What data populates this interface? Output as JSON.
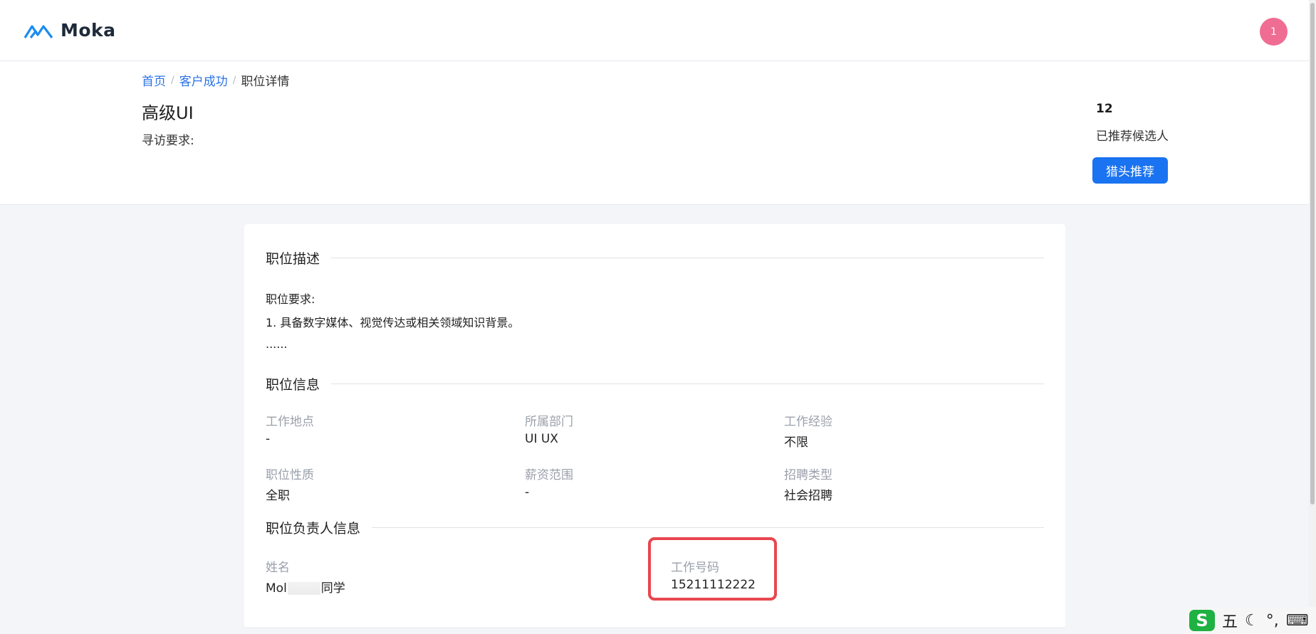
{
  "app": {
    "brand": "Moka",
    "avatar_text": "1"
  },
  "breadcrumb": {
    "items": [
      "首页",
      "客户成功"
    ],
    "current": "职位详情"
  },
  "job": {
    "title": "高级UI",
    "search_requirement_label": "寻访要求:",
    "recommended_count": "12",
    "recommended_label": "已推荐候选人",
    "headhunter_button": "猎头推荐"
  },
  "description": {
    "section_title": "职位描述",
    "lines": [
      "职位要求:",
      "1. 具备数字媒体、视觉传达或相关领域知识背景。",
      "......"
    ]
  },
  "info": {
    "section_title": "职位信息",
    "fields": [
      {
        "label": "工作地点",
        "value": "-"
      },
      {
        "label": "所属部门",
        "value": "UI UX"
      },
      {
        "label": "工作经验",
        "value": "不限"
      },
      {
        "label": "职位性质",
        "value": "全职"
      },
      {
        "label": "薪资范围",
        "value": "-"
      },
      {
        "label": "招聘类型",
        "value": "社会招聘"
      }
    ]
  },
  "owner": {
    "section_title": "职位负责人信息",
    "name_label": "姓名",
    "name_prefix": "Mol",
    "name_suffix": "同学",
    "phone_label": "工作号码",
    "phone_value": "15211112222"
  },
  "ime": {
    "logo": "S",
    "items": [
      "五",
      "☾",
      "°,",
      "⌨"
    ]
  },
  "colors": {
    "accent": "#1a73f0",
    "link": "#2b73e6",
    "avatar": "#ef6d92",
    "highlight": "#e8474f",
    "ime_logo": "#1fb141"
  }
}
